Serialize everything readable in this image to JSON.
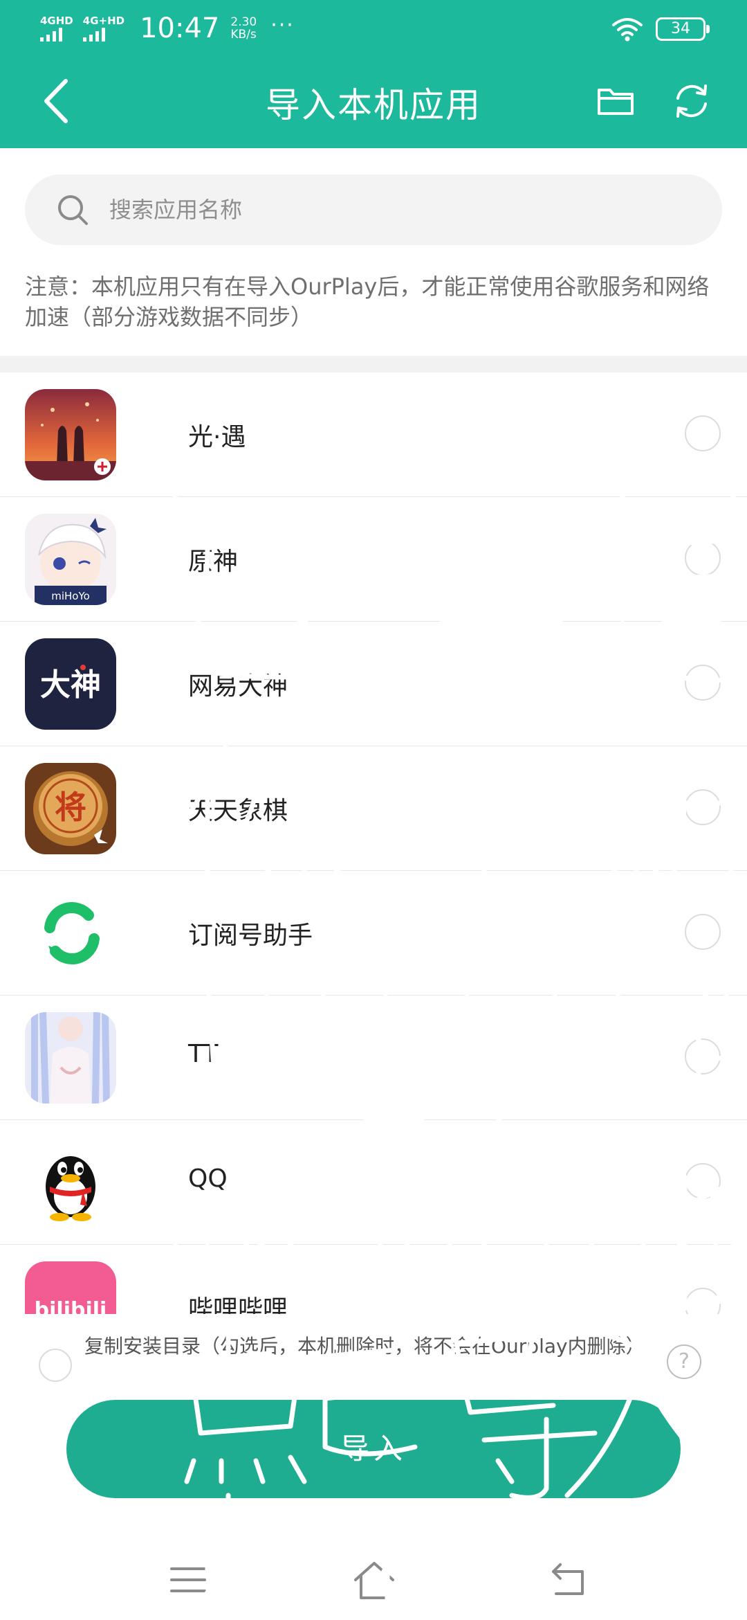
{
  "status_bar": {
    "signal1": "4GHD",
    "signal2": "4G+HD",
    "time": "10:47",
    "speed_value": "2.30",
    "speed_unit": "KB/s",
    "dots": "···",
    "battery": "34"
  },
  "header": {
    "title": "导入本机应用",
    "back_icon": "chevron-left-icon",
    "folder_icon": "folder-icon",
    "refresh_icon": "refresh-icon",
    "background_color": "#1db99c"
  },
  "search": {
    "placeholder": "搜索应用名称",
    "value": ""
  },
  "notice": "注意：本机应用只有在导入OurPlay后，才能正常使用谷歌服务和网络加速（部分游戏数据不同步）",
  "apps": [
    {
      "name": "光·遇",
      "selected": false
    },
    {
      "name": "原神",
      "selected": false
    },
    {
      "name": "网易大神",
      "selected": false
    },
    {
      "name": "天天象棋",
      "selected": false
    },
    {
      "name": "订阅号助手",
      "selected": false
    },
    {
      "name": "TT",
      "selected": false
    },
    {
      "name": "QQ",
      "selected": false
    },
    {
      "name": "哔哩哔哩",
      "selected": false
    }
  ],
  "app_icon_labels": {
    "genshin": "miHoYo",
    "netease_dashen": "大神",
    "chess_piece": "将",
    "bilibili": "bilibili"
  },
  "copy_option": {
    "label": "复制安装目录（勾选后，本机删除时，将不会在Ourplay内删除）",
    "checked": false,
    "help": "?"
  },
  "import_button": "导入",
  "nav_bar": {
    "menu_icon": "menu-icon",
    "home_icon": "home-icon",
    "back_icon": "back-arrow-icon"
  },
  "handwriting": "这里是你手机里的软件 找到胡桃 点一导入就行"
}
